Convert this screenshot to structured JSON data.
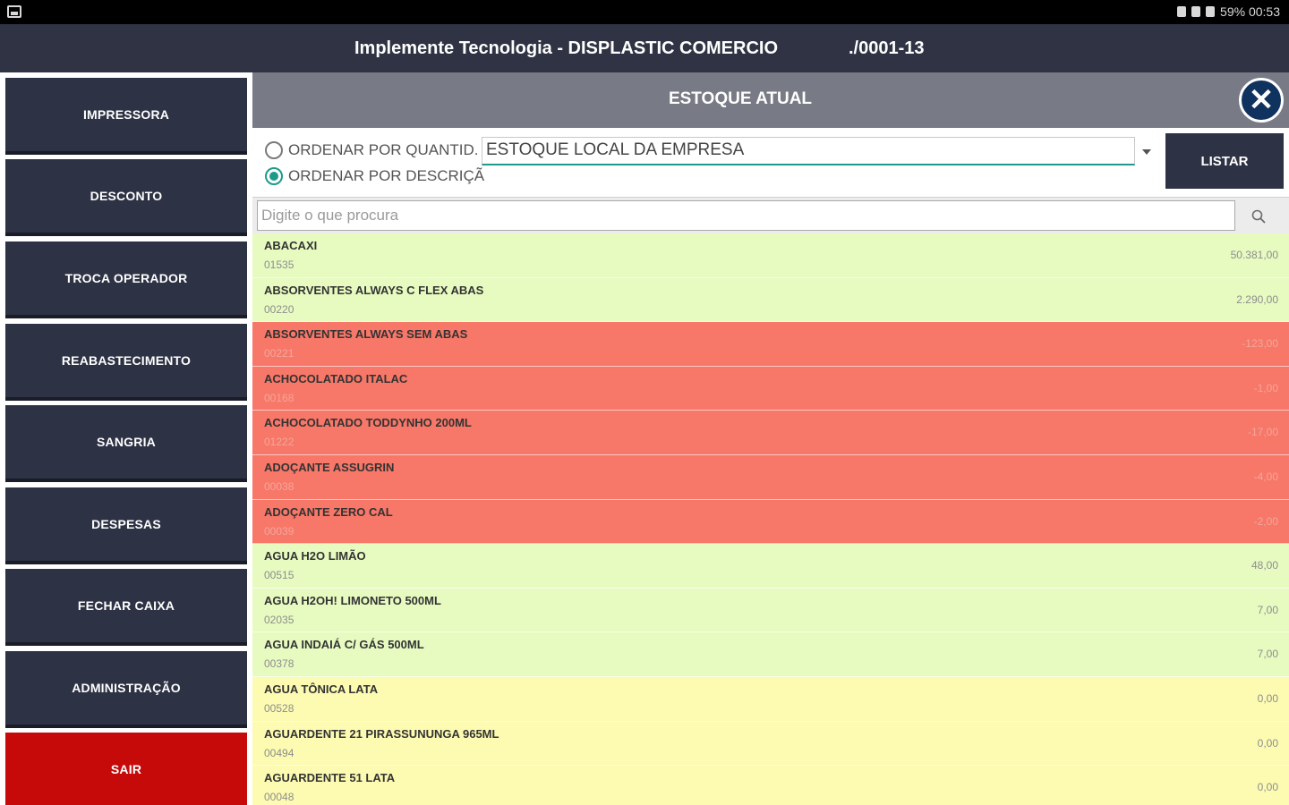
{
  "status_bar": {
    "time_text": "59% 00:53"
  },
  "window": {
    "title": "Implemente Tecnologia - DISPLASTIC COMERCIO",
    "cnpj": "./0001-13"
  },
  "sidebar": {
    "items": [
      {
        "label": "IMPRESSORA"
      },
      {
        "label": "DESCONTO"
      },
      {
        "label": "TROCA OPERADOR"
      },
      {
        "label": "REABASTECIMENTO"
      },
      {
        "label": "SANGRIA"
      },
      {
        "label": "DESPESAS"
      },
      {
        "label": "FECHAR CAIXA"
      },
      {
        "label": "ADMINISTRAÇÃO"
      },
      {
        "label": "SAIR"
      }
    ]
  },
  "panel": {
    "title": "ESTOQUE ATUAL",
    "close_icon": "close-icon",
    "options": {
      "order_by_quantity": "ORDENAR POR QUANTID.",
      "order_by_description": "ORDENAR POR DESCRIÇÃ",
      "selected": "order_by_description",
      "stock_select_value": "ESTOQUE LOCAL DA EMPRESA",
      "list_button": "LISTAR"
    },
    "search": {
      "placeholder": "Digite o que procura",
      "value": ""
    },
    "colors": {
      "positive": "#e7fbc1",
      "negative": "#f77768",
      "zero": "#fdfbb1"
    },
    "items": [
      {
        "name": "ABACAXI",
        "code": "01535",
        "qty": "50.381,00",
        "status": "positive"
      },
      {
        "name": "ABSORVENTES ALWAYS C FLEX ABAS",
        "code": "00220",
        "qty": "2.290,00",
        "status": "positive"
      },
      {
        "name": "ABSORVENTES ALWAYS SEM ABAS",
        "code": "00221",
        "qty": "-123,00",
        "status": "negative"
      },
      {
        "name": "ACHOCOLATADO ITALAC",
        "code": "00168",
        "qty": "-1,00",
        "status": "negative"
      },
      {
        "name": "ACHOCOLATADO TODDYNHO 200ML",
        "code": "01222",
        "qty": "-17,00",
        "status": "negative"
      },
      {
        "name": "ADOÇANTE ASSUGRIN",
        "code": "00038",
        "qty": "-4,00",
        "status": "negative"
      },
      {
        "name": "ADOÇANTE ZERO CAL",
        "code": "00039",
        "qty": "-2,00",
        "status": "negative"
      },
      {
        "name": "AGUA H2O LIMÃO",
        "code": "00515",
        "qty": "48,00",
        "status": "positive"
      },
      {
        "name": "AGUA H2OH! LIMONETO 500ML",
        "code": "02035",
        "qty": "7,00",
        "status": "positive"
      },
      {
        "name": "AGUA INDAIÁ C/ GÁS 500ML",
        "code": "00378",
        "qty": "7,00",
        "status": "positive"
      },
      {
        "name": "AGUA TÔNICA LATA",
        "code": "00528",
        "qty": "0,00",
        "status": "zero"
      },
      {
        "name": "AGUARDENTE 21 PIRASSUNUNGA 965ML",
        "code": "00494",
        "qty": "0,00",
        "status": "zero"
      },
      {
        "name": "AGUARDENTE 51 LATA",
        "code": "00048",
        "qty": "0,00",
        "status": "zero"
      }
    ]
  }
}
